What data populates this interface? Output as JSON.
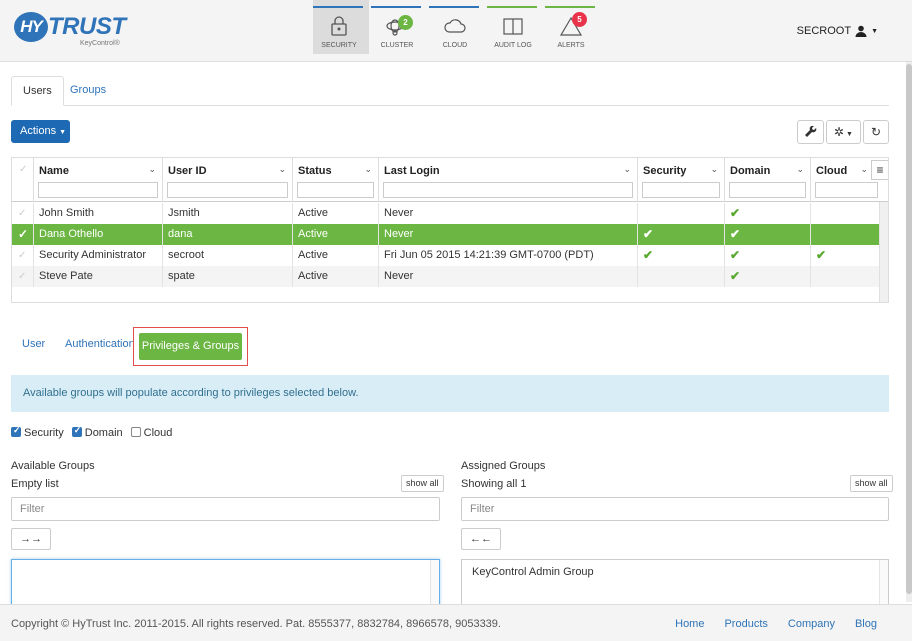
{
  "brand": {
    "name": "TRUST",
    "mark": "HY",
    "subtitle": "KeyControl®"
  },
  "nav": [
    {
      "key": "security",
      "label": "SECURITY",
      "bar_color": "#2f74b8",
      "active": true,
      "icon": "lock-icon",
      "badge": ""
    },
    {
      "key": "cluster",
      "label": "CLUSTER",
      "bar_color": "#2f74b8",
      "active": false,
      "icon": "cluster-icon",
      "badge": "2",
      "badge_color": "#6cb644"
    },
    {
      "key": "cloud",
      "label": "CLOUD",
      "bar_color": "#2f74b8",
      "active": false,
      "icon": "cloud-icon",
      "badge": ""
    },
    {
      "key": "audit",
      "label": "AUDIT LOG",
      "bar_color": "#6cb644",
      "active": false,
      "icon": "book-icon",
      "badge": ""
    },
    {
      "key": "alerts",
      "label": "ALERTS",
      "bar_color": "#6cb644",
      "active": false,
      "icon": "warning-icon",
      "badge": "5",
      "badge_color": "#e8334a"
    }
  ],
  "user_menu": {
    "label": "SECROOT"
  },
  "top_tabs": [
    "Users",
    "Groups"
  ],
  "actions_label": "Actions",
  "table": {
    "columns": [
      "Name",
      "User ID",
      "Status",
      "Last Login",
      "Security",
      "Domain",
      "Cloud"
    ],
    "rows": [
      {
        "name": "John Smith",
        "user_id": "Jsmith",
        "status": "Active",
        "last_login": "Never",
        "security": false,
        "domain": true,
        "cloud": false,
        "selected": false
      },
      {
        "name": "Dana Othello",
        "user_id": "dana",
        "status": "Active",
        "last_login": "Never",
        "security": true,
        "domain": true,
        "cloud": false,
        "selected": true
      },
      {
        "name": "Security Administrator",
        "user_id": "secroot",
        "status": "Active",
        "last_login": "Fri Jun 05 2015 14:21:39 GMT-0700 (PDT)",
        "security": true,
        "domain": true,
        "cloud": true,
        "selected": false
      },
      {
        "name": "Steve Pate",
        "user_id": "spate",
        "status": "Active",
        "last_login": "Never",
        "security": false,
        "domain": true,
        "cloud": false,
        "selected": false
      }
    ]
  },
  "sub_tabs": {
    "user": "User",
    "auth": "Authentication",
    "privileges": "Privileges & Groups"
  },
  "info_text": "Available groups will populate according to privileges selected below.",
  "privileges": [
    {
      "label": "Security",
      "checked": true
    },
    {
      "label": "Domain",
      "checked": true
    },
    {
      "label": "Cloud",
      "checked": false
    }
  ],
  "available": {
    "title": "Available Groups",
    "status": "Empty list",
    "show_all": "show all",
    "filter_placeholder": "Filter",
    "move": "→→"
  },
  "assigned": {
    "title": "Assigned Groups",
    "status": "Showing all 1",
    "show_all": "show all",
    "filter_placeholder": "Filter",
    "move": "←←",
    "items": [
      "KeyControl Admin Group"
    ]
  },
  "footer": {
    "copyright": "Copyright © HyTrust Inc. 2011-2015. All rights reserved. Pat. 8555377, 8832784, 8966578, 9053339.",
    "links": [
      "Home",
      "Products",
      "Company",
      "Blog"
    ]
  }
}
